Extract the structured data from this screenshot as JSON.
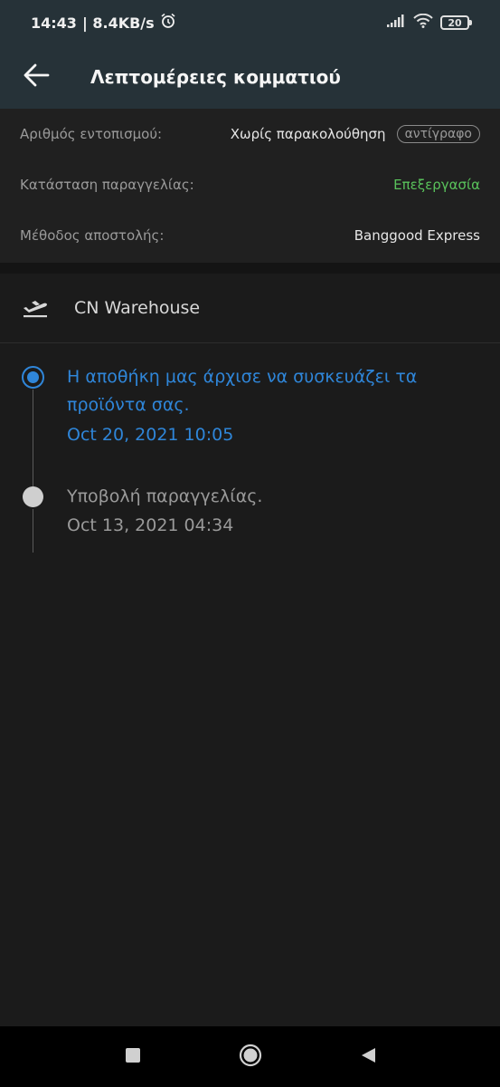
{
  "status_bar": {
    "time": "14:43",
    "network_speed": "| 8.4KB/s",
    "battery": "20",
    "icons": [
      "alarm-icon",
      "signal-icon",
      "wifi-icon",
      "battery-icon"
    ]
  },
  "header": {
    "title": "Λεπτομέρειες κομματιού",
    "back_icon": "arrow-left-icon"
  },
  "info": {
    "tracking_label": "Αριθμός εντοπισμού:",
    "tracking_value": "Χωρίς παρακολούθηση",
    "copy_label": "αντίγραφο",
    "status_label": "Κατάσταση παραγγελίας:",
    "status_value": "Επεξεργασία",
    "method_label": "Μέθοδος αποστολής:",
    "method_value": "Banggood Express"
  },
  "warehouse": {
    "icon": "plane-takeoff-icon",
    "name": "CN Warehouse"
  },
  "timeline": [
    {
      "text": "Η αποθήκη μας άρχισε να συσκευάζει τα προϊόντα σας.",
      "timestamp": "Oct 20, 2021 10:05",
      "active": true
    },
    {
      "text": "Υποβολή παραγγελίας.",
      "timestamp": "Oct 13, 2021 04:34",
      "active": false
    }
  ],
  "nav_bar": {
    "buttons": [
      "recents-square-icon",
      "home-circle-icon",
      "back-triangle-icon"
    ]
  },
  "colors": {
    "accent_blue": "#2f86d9",
    "status_green": "#59c25b",
    "header_bg": "#263238",
    "page_bg": "#1b1b1b"
  }
}
